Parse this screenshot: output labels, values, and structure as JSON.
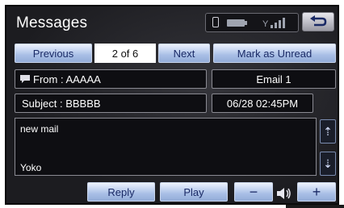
{
  "app": {
    "title": "Messages"
  },
  "status": {
    "icons": [
      "phone-icon",
      "battery-icon",
      "signal-icon"
    ]
  },
  "header": {
    "back_icon": "back-arrow-icon"
  },
  "navigation": {
    "previous_label": "Previous",
    "page_indicator": "2 of 6",
    "next_label": "Next",
    "mark_unread_label": "Mark as Unread"
  },
  "message": {
    "from_label": "From : AAAAA",
    "email_account": "Email 1",
    "subject_label": "Subject : BBBBB",
    "datetime": "06/28 02:45PM",
    "body_line1": "new mail",
    "body_line2": "Yoko"
  },
  "controls": {
    "reply_label": "Reply",
    "play_label": "Play",
    "volume_down_label": "−",
    "volume_up_label": "+",
    "scroll_up_icon": "scroll-up-icon",
    "scroll_down_icon": "scroll-down-icon"
  },
  "colors": {
    "accent": "#a9bfe6",
    "background": "#1e1e22",
    "text": "#ffffff"
  }
}
